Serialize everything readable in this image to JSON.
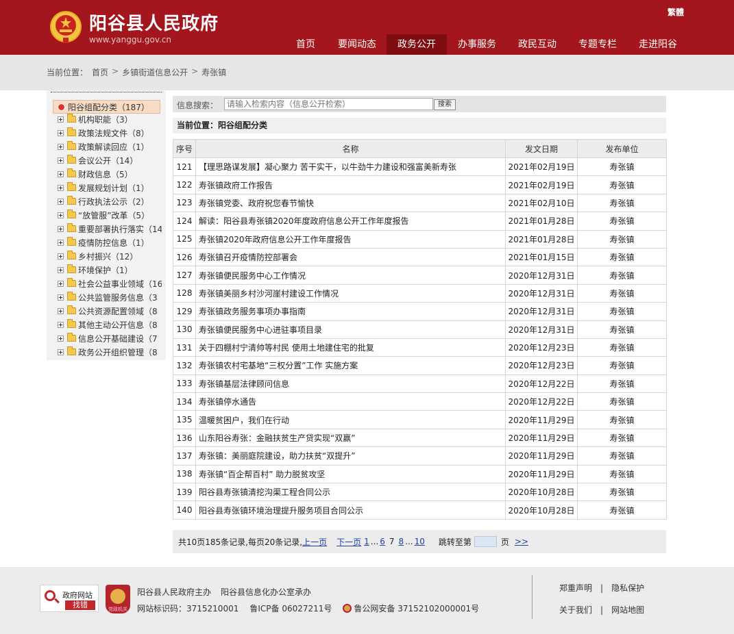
{
  "header": {
    "title": "阳谷县人民政府",
    "url": "www.yanggu.gov.cn",
    "lang_toggle": "繁體",
    "nav": [
      {
        "label": "首页",
        "active": false
      },
      {
        "label": "要闻动态",
        "active": false
      },
      {
        "label": "政务公开",
        "active": true
      },
      {
        "label": "办事服务",
        "active": false
      },
      {
        "label": "政民互动",
        "active": false
      },
      {
        "label": "专题专栏",
        "active": false
      },
      {
        "label": "走进阳谷",
        "active": false
      }
    ]
  },
  "breadcrumb": {
    "label": "当前位置：",
    "items": [
      "首页",
      "乡镇街道信息公开",
      "寿张镇"
    ],
    "separator": ">"
  },
  "sidebar": {
    "root": "阳谷组配分类（187）",
    "items": [
      "机构职能（3）",
      "政策法规文件（8）",
      "政策解读回应（1）",
      "会议公开（14）",
      "财政信息（5）",
      "发展规划计划（1）",
      "行政执法公示（2）",
      "“放管服”改革（5）",
      "重要部署执行落实（14",
      "疫情防控信息（1）",
      "乡村振兴（12）",
      "环境保护（1）",
      "社会公益事业领域（16",
      "公共监管服务信息（3",
      "公共资源配置领域（8",
      "其他主动公开信息（8",
      "信息公开基础建设（7",
      "政务公开组织管理（8"
    ]
  },
  "search": {
    "label": "信息搜索：",
    "placeholder": "请输入检索内容（信息公开检索）",
    "button": "搜索"
  },
  "current_position": "当前位置：阳谷组配分类",
  "table": {
    "headers": [
      "序号",
      "名称",
      "发文日期",
      "发布单位"
    ],
    "rows": [
      {
        "no": "121",
        "title": "【理思路谋发展】凝心聚力 苦干实干，以牛劲牛力建设和强富美新寿张",
        "date": "2021年02月19日",
        "unit": "寿张镇"
      },
      {
        "no": "122",
        "title": "寿张镇政府工作报告",
        "date": "2021年02月19日",
        "unit": "寿张镇"
      },
      {
        "no": "123",
        "title": "寿张镇党委、政府祝您春节愉快",
        "date": "2021年02月10日",
        "unit": "寿张镇"
      },
      {
        "no": "124",
        "title": "解读：阳谷县寿张镇2020年度政府信息公开工作年度报告",
        "date": "2021年01月28日",
        "unit": "寿张镇"
      },
      {
        "no": "125",
        "title": "寿张镇2020年政府信息公开工作年度报告",
        "date": "2021年01月28日",
        "unit": "寿张镇"
      },
      {
        "no": "126",
        "title": "寿张镇召开疫情防控部署会",
        "date": "2021年01月15日",
        "unit": "寿张镇"
      },
      {
        "no": "127",
        "title": "寿张镇便民服务中心工作情况",
        "date": "2020年12月31日",
        "unit": "寿张镇"
      },
      {
        "no": "128",
        "title": "寿张镇美丽乡村沙河崖村建设工作情况",
        "date": "2020年12月31日",
        "unit": "寿张镇"
      },
      {
        "no": "129",
        "title": "寿张镇政务服务事项办事指南",
        "date": "2020年12月31日",
        "unit": "寿张镇"
      },
      {
        "no": "130",
        "title": "寿张镇便民服务中心进驻事项目录",
        "date": "2020年12月31日",
        "unit": "寿张镇"
      },
      {
        "no": "131",
        "title": "关于四棚村宁清帅等村民 使用土地建住宅的批复",
        "date": "2020年12月23日",
        "unit": "寿张镇"
      },
      {
        "no": "132",
        "title": "寿张镇农村宅基地“三权分置”工作 实施方案",
        "date": "2020年12月23日",
        "unit": "寿张镇"
      },
      {
        "no": "133",
        "title": "寿张镇基层法律顾问信息",
        "date": "2020年12月22日",
        "unit": "寿张镇"
      },
      {
        "no": "134",
        "title": "寿张镇停水通告",
        "date": "2020年12月22日",
        "unit": "寿张镇"
      },
      {
        "no": "135",
        "title": "温暖贫困户，我们在行动",
        "date": "2020年11月29日",
        "unit": "寿张镇"
      },
      {
        "no": "136",
        "title": "山东阳谷寿张：金融扶贫生产贷实现“双赢”",
        "date": "2020年11月29日",
        "unit": "寿张镇"
      },
      {
        "no": "137",
        "title": "寿张镇：美丽庭院建设，助力扶贫“双提升”",
        "date": "2020年11月29日",
        "unit": "寿张镇"
      },
      {
        "no": "138",
        "title": "寿张镇“百企帮百村” 助力脱贫攻坚",
        "date": "2020年11月29日",
        "unit": "寿张镇"
      },
      {
        "no": "139",
        "title": "阳谷县寿张镇清挖沟渠工程合同公示",
        "date": "2020年10月28日",
        "unit": "寿张镇"
      },
      {
        "no": "140",
        "title": "阳谷县寿张镇环境治理提升服务项目合同公示",
        "date": "2020年10月28日",
        "unit": "寿张镇"
      }
    ]
  },
  "pagination": {
    "summary": "共10页185条记录,每页20条记录,",
    "prev": "上一页",
    "next": "下一页",
    "first_page": "1",
    "ellipsis1": "...",
    "page6": "6",
    "current": "7",
    "page8": "8",
    "ellipsis2": "...",
    "last_page": "10",
    "jump_label": "跳转至第",
    "page_unit": "页",
    "go": ">>"
  },
  "footer": {
    "find_error_top": "政府网站",
    "find_error_bottom": "找错",
    "badge_text": "党政机关",
    "host": "阳谷县人民政府主办",
    "organizer": "阳谷县信息化办公室承办",
    "site_id": "网站标识码：3715210001",
    "icp": "鲁ICP备 06027211号",
    "police": "鲁公网安备 37152102000001号",
    "links": [
      "郑重声明",
      "隐私保护",
      "关于我们",
      "网站地图"
    ],
    "link_separator": "|"
  }
}
